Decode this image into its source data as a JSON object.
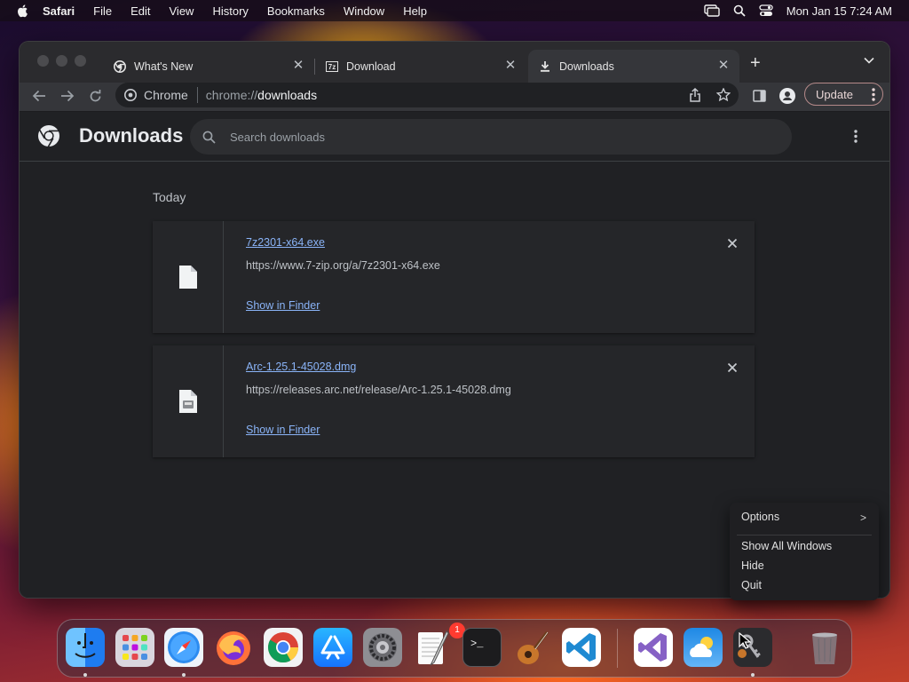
{
  "menubar": {
    "app_name": "Safari",
    "items": [
      "File",
      "Edit",
      "View",
      "History",
      "Bookmarks",
      "Window",
      "Help"
    ],
    "clock": "Mon Jan 15  7:24 AM"
  },
  "tabs": [
    {
      "title": "What's New"
    },
    {
      "title": "Download"
    },
    {
      "title": "Downloads"
    }
  ],
  "toolbar": {
    "site_chip": "Chrome",
    "url_scheme": "chrome://",
    "url_host": "downloads",
    "update_label": "Update"
  },
  "downloads_page": {
    "title": "Downloads",
    "search_placeholder": "Search downloads",
    "date_group": "Today",
    "items": [
      {
        "file_name": "7z2301-x64.exe",
        "url": "https://www.7-zip.org/a/7z2301-x64.exe",
        "action": "Show in Finder"
      },
      {
        "file_name": "Arc-1.25.1-45028.dmg",
        "url": "https://releases.arc.net/release/Arc-1.25.1-45028.dmg",
        "action": "Show in Finder"
      }
    ]
  },
  "context_menu": {
    "items": [
      "Options",
      "Show All Windows",
      "Hide",
      "Quit"
    ]
  },
  "dock": {
    "apps": [
      "finder-icon",
      "launchpad-icon",
      "safari-icon",
      "firefox-icon",
      "chrome-icon",
      "app-store-icon",
      "system-settings-icon",
      "textedit-icon",
      "terminal-icon",
      "garageband-icon",
      "vscode-icon",
      "visual-studio-icon",
      "weather-icon",
      "keychain-icon",
      "trash-icon"
    ],
    "settings_badge": "1"
  },
  "colors": {
    "link": "#8ab4f8",
    "page_bg": "#202124",
    "badge": "#ff3b30"
  }
}
